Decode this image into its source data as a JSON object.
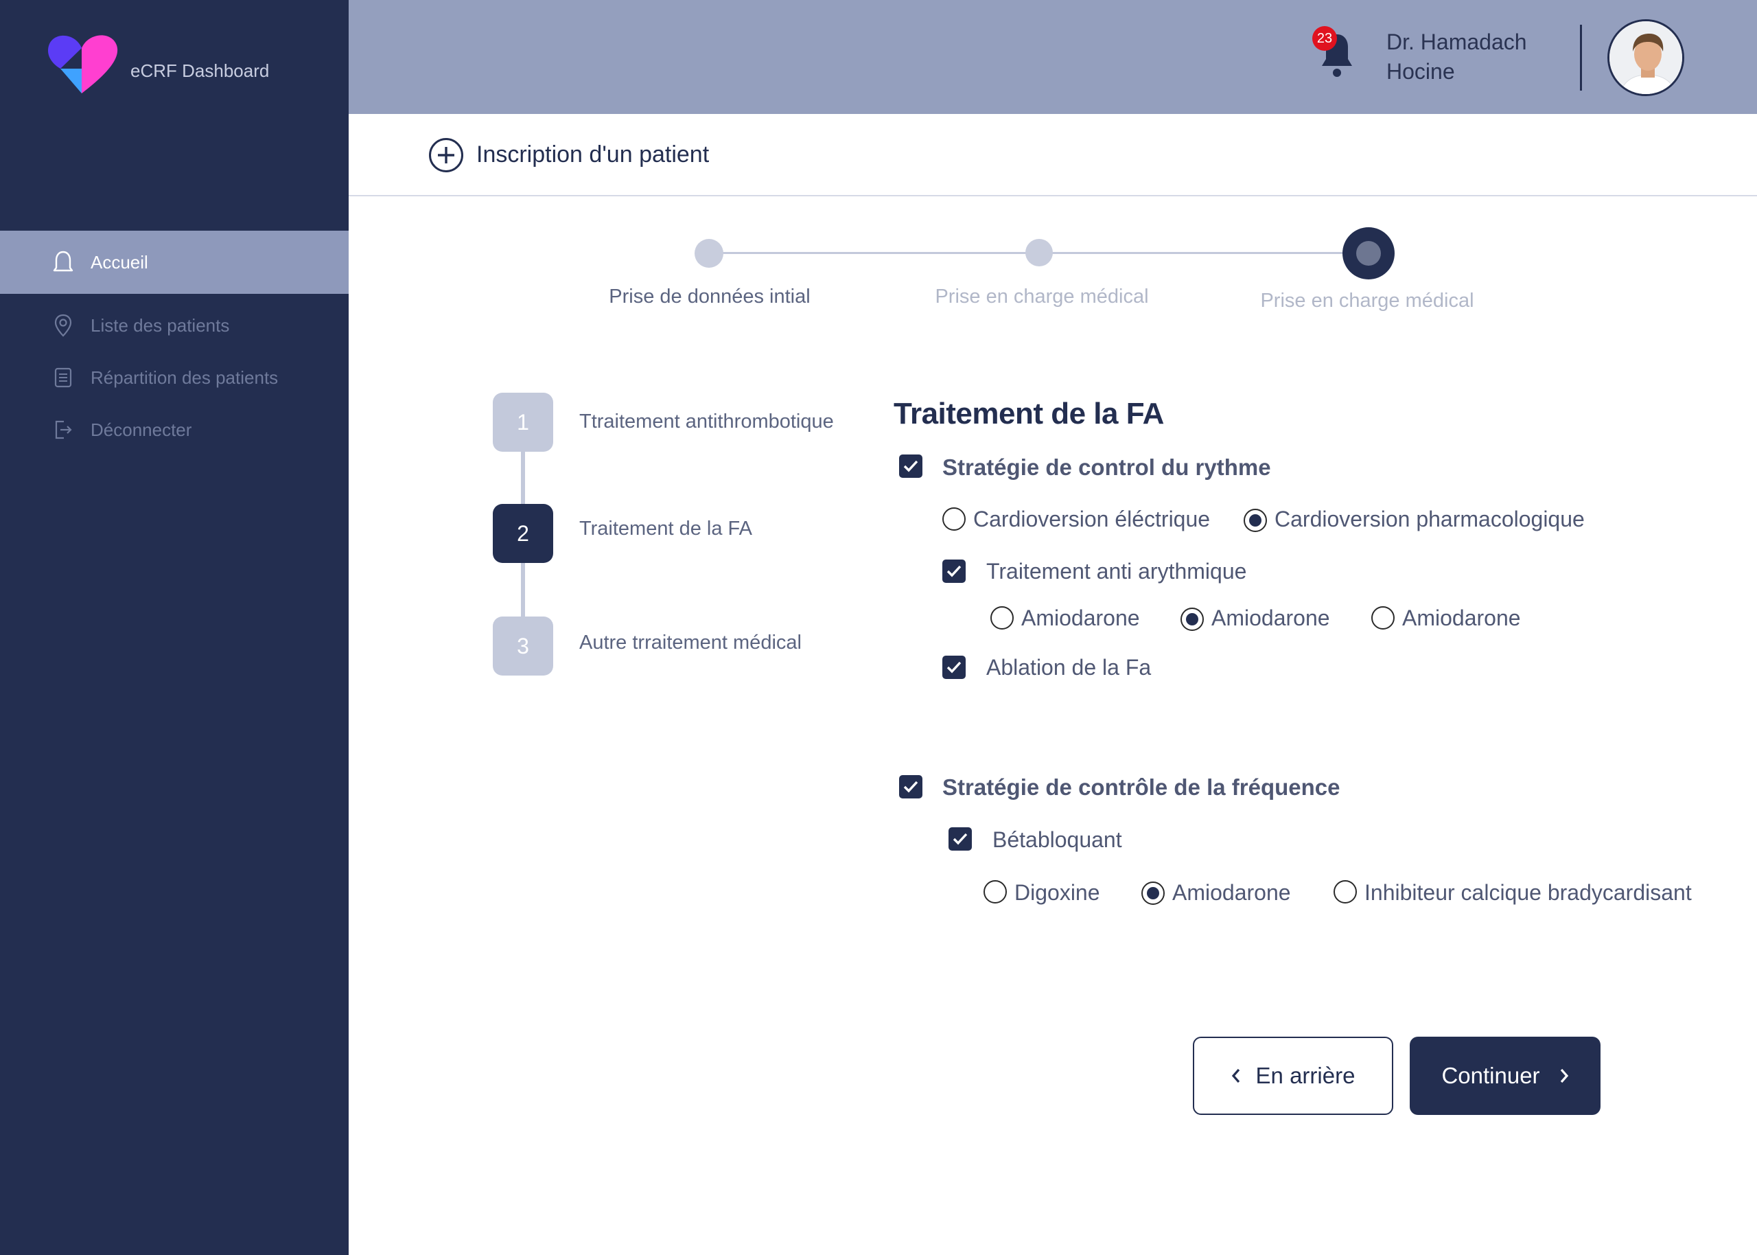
{
  "app": {
    "name": "eCRF Dashboard"
  },
  "sidebar": {
    "items": [
      {
        "label": "Accueil",
        "icon": "bell-outline-icon",
        "active": true
      },
      {
        "label": "Liste des patients",
        "icon": "location-pin-icon",
        "active": false
      },
      {
        "label": "Répartition  des patients",
        "icon": "document-list-icon",
        "active": false
      },
      {
        "label": "Déconnecter",
        "icon": "logout-icon",
        "active": false
      }
    ]
  },
  "header": {
    "notification_count": "23",
    "user_name": "Dr. Hamadach Hocine"
  },
  "page": {
    "title": "Inscription d'un patient"
  },
  "stepper": {
    "steps": [
      {
        "label": "Prise de données intial",
        "state": "done"
      },
      {
        "label": "Prise en charge médical",
        "state": "pending"
      },
      {
        "label": "Prise en charge médical",
        "state": "current"
      }
    ]
  },
  "substeps": [
    {
      "number": "1",
      "label": "Ttraitement antithrombotique",
      "active": false
    },
    {
      "number": "2",
      "label": "Traitement de la FA",
      "active": true
    },
    {
      "number": "3",
      "label": "Autre trraitement médical",
      "active": false
    }
  ],
  "form": {
    "title": "Traitement de la FA",
    "rhythm": {
      "label": "Stratégie de control du rythme",
      "checked": true,
      "cardioversion_options": [
        {
          "label": "Cardioversion éléctrique",
          "selected": false
        },
        {
          "label": "Cardioversion pharmacologique",
          "selected": true
        }
      ],
      "anti_arrhythmic": {
        "label": "Traitement anti arythmique",
        "checked": true,
        "options": [
          {
            "label": "Amiodarone",
            "selected": false
          },
          {
            "label": "Amiodarone",
            "selected": true
          },
          {
            "label": "Amiodarone",
            "selected": false
          }
        ]
      },
      "ablation": {
        "label": "Ablation de la Fa",
        "checked": true
      }
    },
    "frequency": {
      "label": "Stratégie de contrôle de la fréquence",
      "checked": true,
      "beta_blocker": {
        "label": "Bétabloquant",
        "checked": true,
        "options": [
          {
            "label": "Digoxine",
            "selected": false
          },
          {
            "label": "Amiodarone",
            "selected": true
          },
          {
            "label": "Inhibiteur calcique bradycardisant",
            "selected": false
          }
        ]
      }
    }
  },
  "actions": {
    "back_label": "En arrière",
    "continue_label": "Continuer"
  },
  "colors": {
    "primary": "#232e50",
    "sidebar_active": "#8e99bb",
    "header_bg": "#949fbe",
    "badge": "#e0121f",
    "logo_purple": "#5b3cf5",
    "logo_pink": "#ff3fd0",
    "logo_blue": "#3fa2ff"
  }
}
